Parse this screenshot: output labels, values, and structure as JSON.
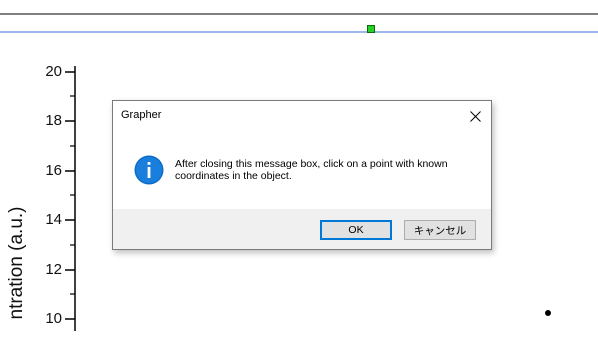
{
  "dialog": {
    "title": "Grapher",
    "message": "After closing this message box, click on a point with known coordinates in the object.",
    "ok_label": "OK",
    "cancel_label": "キャンセル"
  },
  "plot": {
    "ylabel": "ntration (a.u.)",
    "y_ticks": [
      "20",
      "18",
      "16",
      "14",
      "12",
      "10"
    ]
  },
  "colors": {
    "accent": "#0078d7",
    "info_icon": "#0a6cc8",
    "selection_handle": "#26d026",
    "guide_line": "#3b6fd6"
  }
}
